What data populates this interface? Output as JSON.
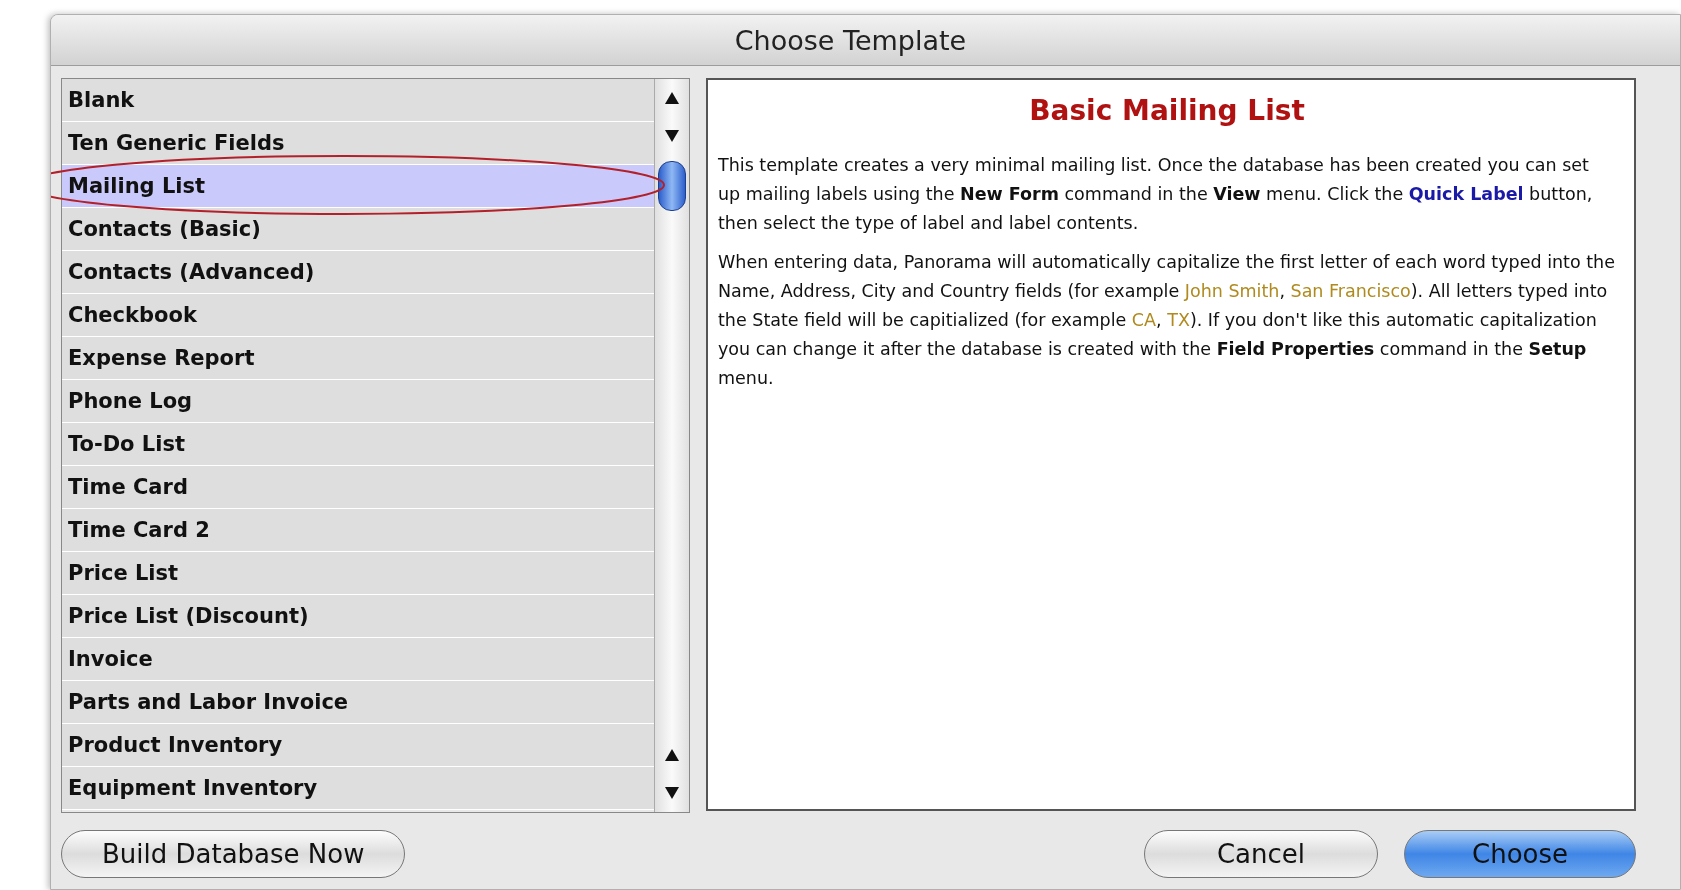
{
  "window": {
    "title": "Choose Template"
  },
  "templates": [
    {
      "label": "Blank",
      "selected": false
    },
    {
      "label": "Ten Generic Fields",
      "selected": false
    },
    {
      "label": "Mailing List",
      "selected": true
    },
    {
      "label": "Contacts (Basic)",
      "selected": false
    },
    {
      "label": "Contacts (Advanced)",
      "selected": false
    },
    {
      "label": "Checkbook",
      "selected": false
    },
    {
      "label": "Expense Report",
      "selected": false
    },
    {
      "label": "Phone Log",
      "selected": false
    },
    {
      "label": "To-Do List",
      "selected": false
    },
    {
      "label": "Time Card",
      "selected": false
    },
    {
      "label": "Time Card 2",
      "selected": false
    },
    {
      "label": "Price List",
      "selected": false
    },
    {
      "label": "Price List (Discount)",
      "selected": false
    },
    {
      "label": "Invoice",
      "selected": false
    },
    {
      "label": "Parts and Labor Invoice",
      "selected": false
    },
    {
      "label": "Product Inventory",
      "selected": false
    },
    {
      "label": "Equipment Inventory",
      "selected": false
    }
  ],
  "description": {
    "title": "Basic Mailing List",
    "paragraphs": [
      [
        {
          "kind": "plain",
          "text": "This template creates a very minimal mailing list. Once the database has been created you can set up mailing labels using the "
        },
        {
          "kind": "bold",
          "text": "New Form"
        },
        {
          "kind": "plain",
          "text": " command in the "
        },
        {
          "kind": "bold",
          "text": "View"
        },
        {
          "kind": "plain",
          "text": " menu. Click the "
        },
        {
          "kind": "button",
          "text": "Quick Label"
        },
        {
          "kind": "plain",
          "text": " button, then select the type of label and label contents."
        }
      ],
      [
        {
          "kind": "plain",
          "text": "When entering data, Panorama will automatically capitalize the first letter of each word typed into the Name, Address, City and Country fields (for example "
        },
        {
          "kind": "example",
          "text": "John Smith"
        },
        {
          "kind": "plain",
          "text": ", "
        },
        {
          "kind": "example",
          "text": "San Francisco"
        },
        {
          "kind": "plain",
          "text": "). All letters typed into the State field will be capitialized (for example "
        },
        {
          "kind": "example",
          "text": "CA"
        },
        {
          "kind": "plain",
          "text": ", "
        },
        {
          "kind": "example",
          "text": "TX"
        },
        {
          "kind": "plain",
          "text": "). If you don't like this automatic capitalization you can change it after the database is created with the "
        },
        {
          "kind": "bold",
          "text": "Field Properties"
        },
        {
          "kind": "plain",
          "text": " command in the "
        },
        {
          "kind": "bold",
          "text": "Setup"
        },
        {
          "kind": "plain",
          "text": " menu."
        }
      ]
    ]
  },
  "buttons": {
    "build": "Build Database Now",
    "cancel": "Cancel",
    "choose": "Choose"
  }
}
